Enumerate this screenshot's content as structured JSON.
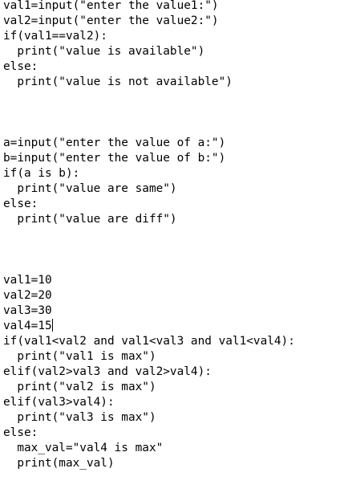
{
  "editor": {
    "lines": [
      "val1=input(\"enter the value1:\")",
      "val2=input(\"enter the value2:\")",
      "if(val1==val2):",
      "  print(\"value is available\")",
      "else:",
      "  print(\"value is not available\")",
      "a=input(\"enter the value of a:\")",
      "b=input(\"enter the value of b:\")",
      "if(a is b):",
      "  print(\"value are same\")",
      "else:",
      "  print(\"value are diff\")",
      "val1=10",
      "val2=20",
      "val3=30",
      "val4=15",
      "if(val1<val2 and val1<val3 and val1<val4):",
      "  print(\"val1 is max\")",
      "elif(val2>val3 and val2>val4):",
      "  print(\"val2 is max\")",
      "elif(val3>val4):",
      "  print(\"val3 is max\")",
      "else:",
      "  max_val=\"val4 is max\"",
      "  print(max_val)"
    ]
  }
}
